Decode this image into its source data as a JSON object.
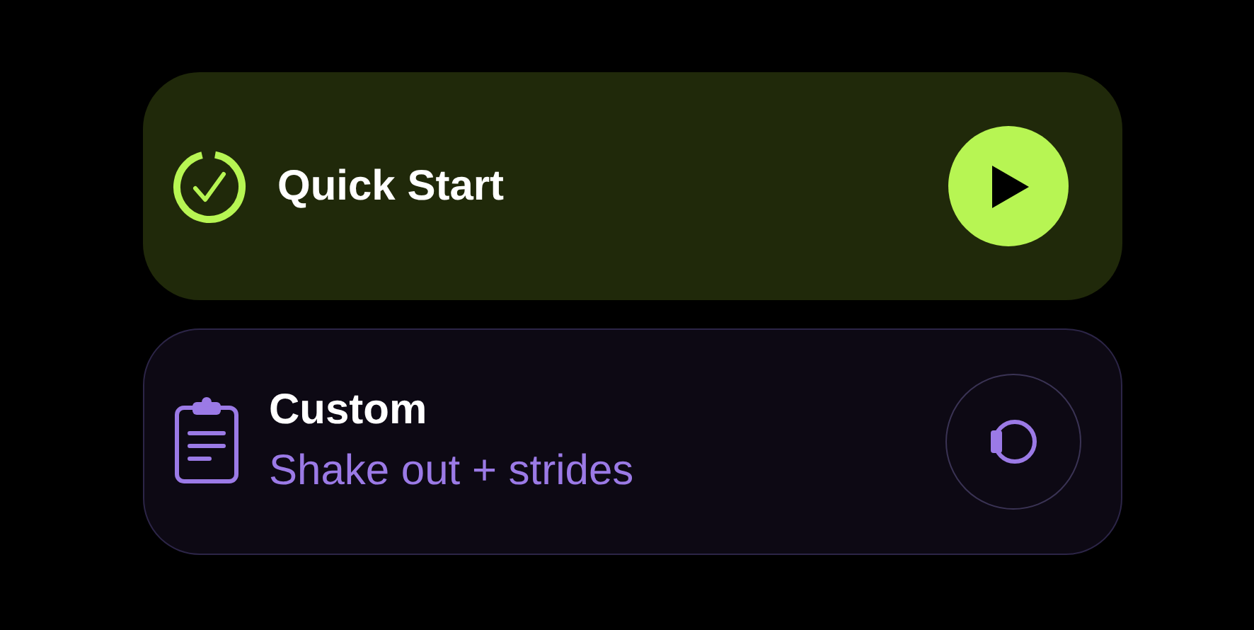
{
  "workouts": [
    {
      "kind": "quick",
      "title": "Quick Start"
    },
    {
      "kind": "custom",
      "title": "Custom",
      "subtitle": "Shake out + strides"
    }
  ]
}
